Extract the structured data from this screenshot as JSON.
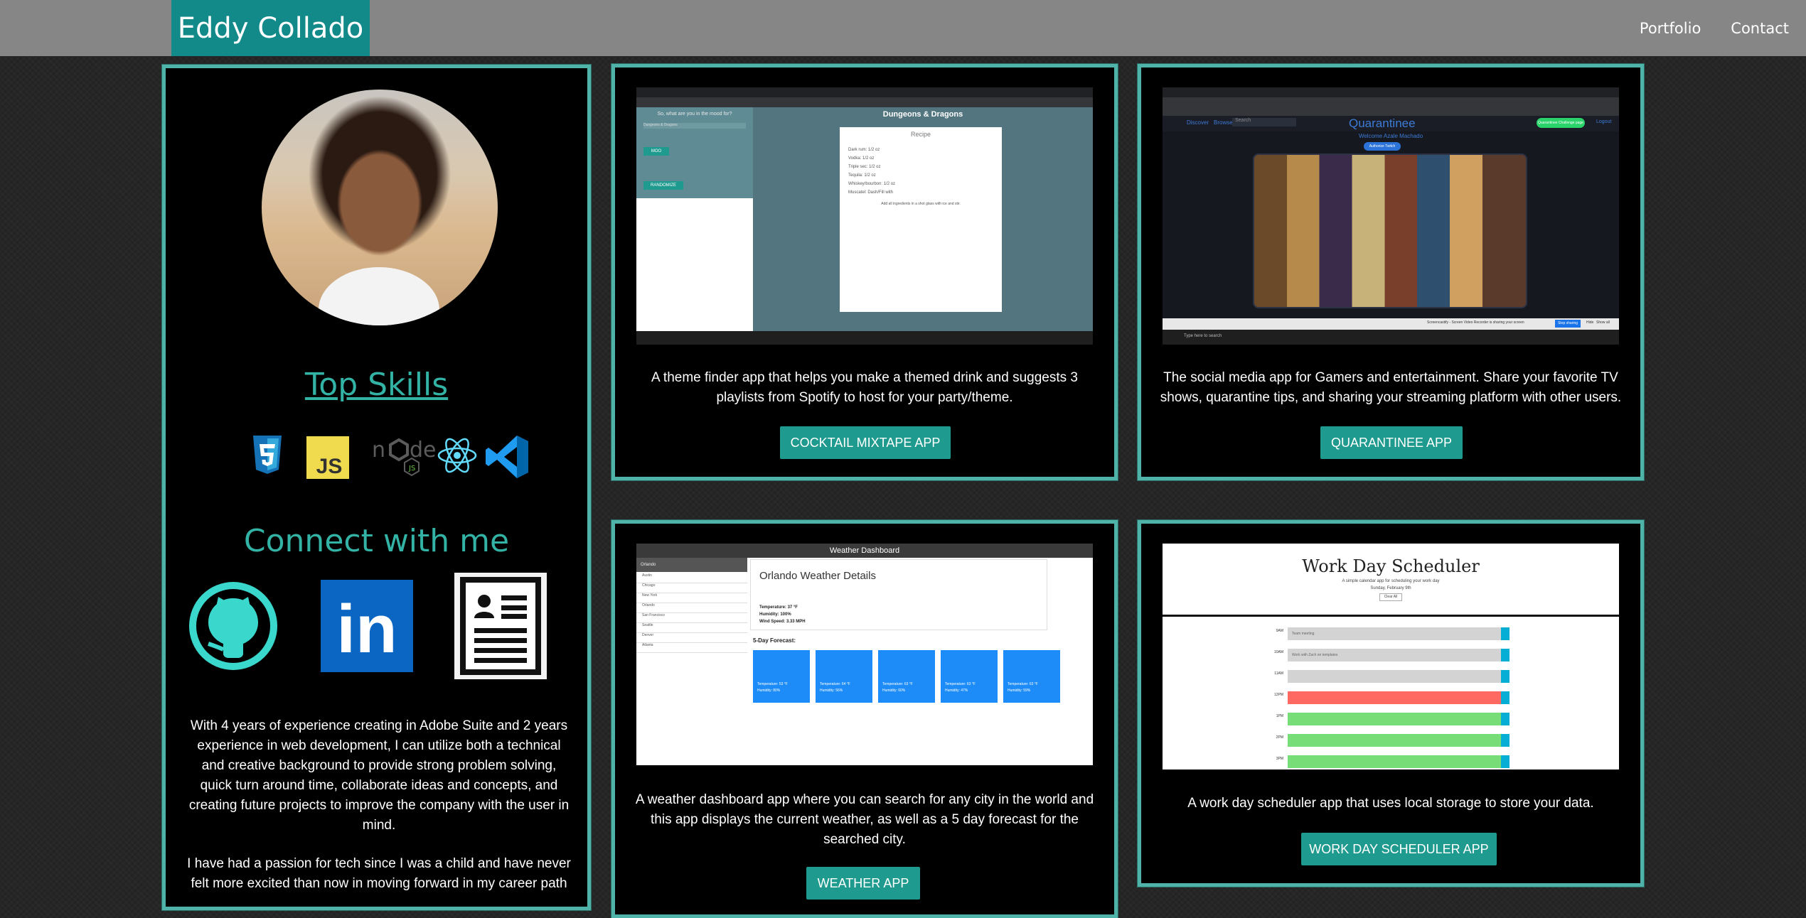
{
  "header": {
    "brand": "Eddy Collado",
    "nav": [
      "Portfolio",
      "Contact"
    ]
  },
  "profile": {
    "skills_title": "Top Skills",
    "skills_icons": [
      "css3-icon",
      "javascript-icon",
      "nodejs-icon",
      "react-icon",
      "vscode-icon"
    ],
    "skill_js_label": "JS",
    "connect_title": "Connect with me",
    "social_icons": [
      "github-icon",
      "linkedin-icon",
      "resume-icon"
    ],
    "linkedin_label": "in",
    "bio": [
      "With 4 years of experience creating in Adobe Suite and 2 years experience in web development, I can utilize both a technical and creative background to provide strong problem solving, quick turn around time, collaborate ideas and concepts, and creating future projects to improve the company with the user in mind.",
      "I have had a passion for tech since I was a child and have never felt more excited than now in moving forward in my career path"
    ]
  },
  "projects": [
    {
      "description": "A theme finder app that helps you make a themed drink and suggests 3 playlists from Spotify to host for your party/theme.",
      "button": "Cocktail Mixtape App",
      "screenshot": {
        "app_title": "Dungeons & Dragons",
        "prompt": "So, what are you in the mood for?",
        "select_value": "Dungeons & Dragons",
        "btn1": "MOO",
        "btn2": "RANDOMIZE",
        "modal_title": "Recipe",
        "ingredients": [
          "Dark rum: 1/2 oz",
          "Vodka: 1/2 oz",
          "Triple sec: 1/2 oz",
          "Tequila: 1/2 oz",
          "Whiskey/bourbon: 1/2 oz",
          "Muscatel: Dash/Fill with"
        ],
        "modal_note": "Add all ingredients in a shot glass with ice and stir."
      }
    },
    {
      "description": "The social media app for Gamers and entertainment. Share your favorite TV shows, quarantine tips, and sharing your streaming platform with other users.",
      "button": "Quarantinee App",
      "screenshot": {
        "app_title": "Quarantinee",
        "welcome": "Welcome Azale Machado",
        "nav1": "Discover",
        "nav2": "Browse",
        "search_placeholder": "Search",
        "post_btn": "Quarantinee Challenge page",
        "logout": "Logout",
        "upload_btn": "Authorize Twitch",
        "taskbar_search": "Type here to search",
        "share_text": "Screencastify - Screen Video Recorder is sharing your screen",
        "stop_sharing": "Stop sharing",
        "hide": "Hide",
        "show_all": "Show all"
      }
    },
    {
      "description": "A weather dashboard app where you can search for any city in the world and this app displays the current weather, as well as a 5 day forecast for the searched city.",
      "button": "Weather App",
      "screenshot": {
        "app_title": "Weather Dashboard",
        "search_value": "Orlando",
        "cities": [
          "Austin",
          "Chicago",
          "New York",
          "Orlando",
          "San Francisco",
          "Seattle",
          "Denver",
          "Atlanta"
        ],
        "details_title": "Orlando Weather Details",
        "temperature": "Temperature: 37 °F",
        "humidity": "Humidity: 100%",
        "wind": "Wind Speed: 3.33 MPH",
        "forecast_title": "5-Day Forecast:",
        "forecast": [
          {
            "temp": "Temperature: 53 °F",
            "hum": "Humidity: 80%"
          },
          {
            "temp": "Temperature: 64 °F",
            "hum": "Humidity: 56%"
          },
          {
            "temp": "Temperature: 63 °F",
            "hum": "Humidity: 60%"
          },
          {
            "temp": "Temperature: 63 °F",
            "hum": "Humidity: 47%"
          },
          {
            "temp": "Temperature: 63 °F",
            "hum": "Humidity: 59%"
          }
        ]
      }
    },
    {
      "description": "A work day scheduler app that uses local storage to store your data.",
      "button": "Work Day Scheduler App",
      "screenshot": {
        "app_title": "Work Day Scheduler",
        "subtitle": "A simple calendar app for scheduling your work day",
        "date": "Sunday, February 9th",
        "clear": "Clear All",
        "rows": [
          {
            "hour": "9AM",
            "text": "Team meeting",
            "state": "past"
          },
          {
            "hour": "10AM",
            "text": "Work with Zach on templates",
            "state": "past"
          },
          {
            "hour": "11AM",
            "text": "",
            "state": "past"
          },
          {
            "hour": "12PM",
            "text": "",
            "state": "present"
          },
          {
            "hour": "1PM",
            "text": "",
            "state": "future"
          },
          {
            "hour": "2PM",
            "text": "",
            "state": "future"
          },
          {
            "hour": "3PM",
            "text": "",
            "state": "future"
          }
        ]
      }
    }
  ],
  "colors": {
    "nav_bg": "#868686",
    "brand_bg": "#128a8a",
    "accent": "#33b3a5",
    "card_border": "#4fb3aa",
    "button_bg": "#1e9a8e"
  }
}
